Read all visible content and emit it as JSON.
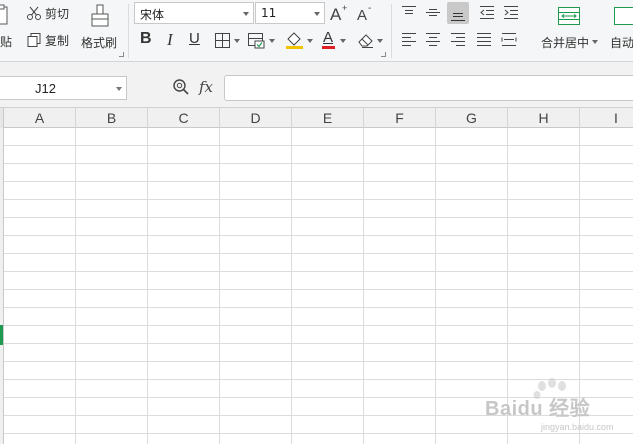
{
  "ribbon": {
    "clipboard": {
      "paste_label": "粘贴",
      "cut_label": "剪切",
      "copy_label": "复制",
      "format_painter_label": "格式刷"
    },
    "font": {
      "font_name": "宋体",
      "font_size": "11",
      "bold": "B",
      "italic": "I",
      "underline": "U",
      "font_color_glyph": "A",
      "highlight_color": "#f2c400",
      "font_color": "#e02020"
    },
    "alignment": {
      "merge_center_label": "合并居中",
      "auto_wrap_label": "自动",
      "active_vertical_align": "bottom"
    }
  },
  "formula_bar": {
    "name_box": "J12",
    "fx_label": "fx",
    "formula_value": ""
  },
  "sheet": {
    "columns": [
      "A",
      "B",
      "C",
      "D",
      "E",
      "F",
      "G",
      "H",
      "I"
    ],
    "selected_row_marker_color": "#1e9b4f"
  },
  "watermark": {
    "text": "Baidu 经验",
    "sub": "jingyan.baidu.com"
  }
}
